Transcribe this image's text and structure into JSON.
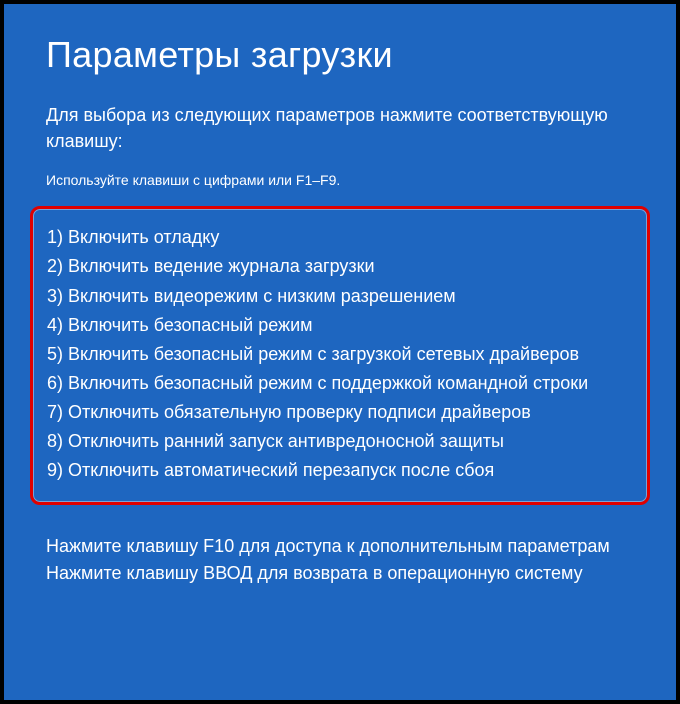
{
  "title": "Параметры загрузки",
  "instruction": "Для выбора из следующих параметров нажмите соответствующую клавишу:",
  "hint": "Используйте клавиши с цифрами или F1–F9.",
  "options": [
    {
      "num": "1",
      "label": "Включить отладку"
    },
    {
      "num": "2",
      "label": "Включить ведение журнала загрузки"
    },
    {
      "num": "3",
      "label": "Включить видеорежим с низким разрешением"
    },
    {
      "num": "4",
      "label": "Включить безопасный режим"
    },
    {
      "num": "5",
      "label": "Включить безопасный режим с загрузкой сетевых драйверов"
    },
    {
      "num": "6",
      "label": "Включить безопасный режим с поддержкой командной строки"
    },
    {
      "num": "7",
      "label": "Отключить обязательную проверку подписи драйверов"
    },
    {
      "num": "8",
      "label": "Отключить ранний запуск антивредоносной защиты"
    },
    {
      "num": "9",
      "label": "Отключить автоматический перезапуск после сбоя"
    }
  ],
  "footer1": "Нажмите клавишу F10 для доступа к дополнительным параметрам",
  "footer2": "Нажмите клавишу ВВОД для возврата в операционную систему"
}
